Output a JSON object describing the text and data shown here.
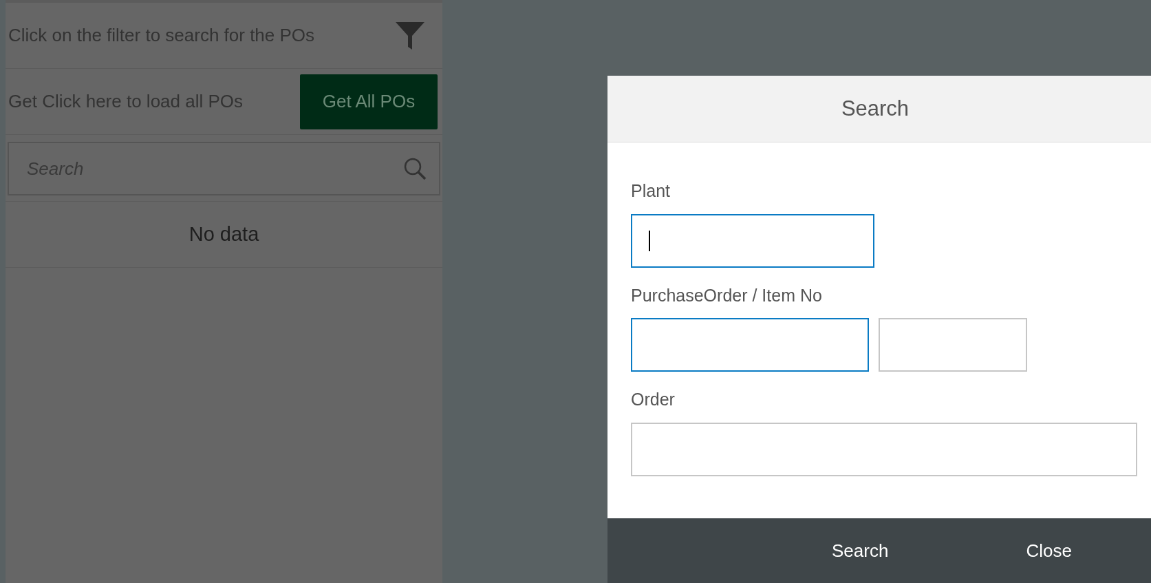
{
  "master": {
    "filter_hint": "Click on the filter to search for the POs",
    "load_hint": "Get Click here to load all POs",
    "load_button": "Get All POs",
    "search": {
      "placeholder": "Search"
    },
    "empty_text": "No data"
  },
  "dialog": {
    "title": "Search",
    "fields": [
      {
        "label": "Plant",
        "inputs": [
          {
            "focused": true,
            "cursor": true
          }
        ]
      },
      {
        "label": "PurchaseOrder / Item No",
        "inputs": [
          {
            "focused": true,
            "cursor": false
          },
          {
            "focused": false,
            "cursor": false
          }
        ]
      },
      {
        "label": "Order",
        "inputs": [
          {
            "focused": false,
            "cursor": false
          }
        ]
      }
    ],
    "buttons": [
      "Search",
      "Close"
    ]
  }
}
